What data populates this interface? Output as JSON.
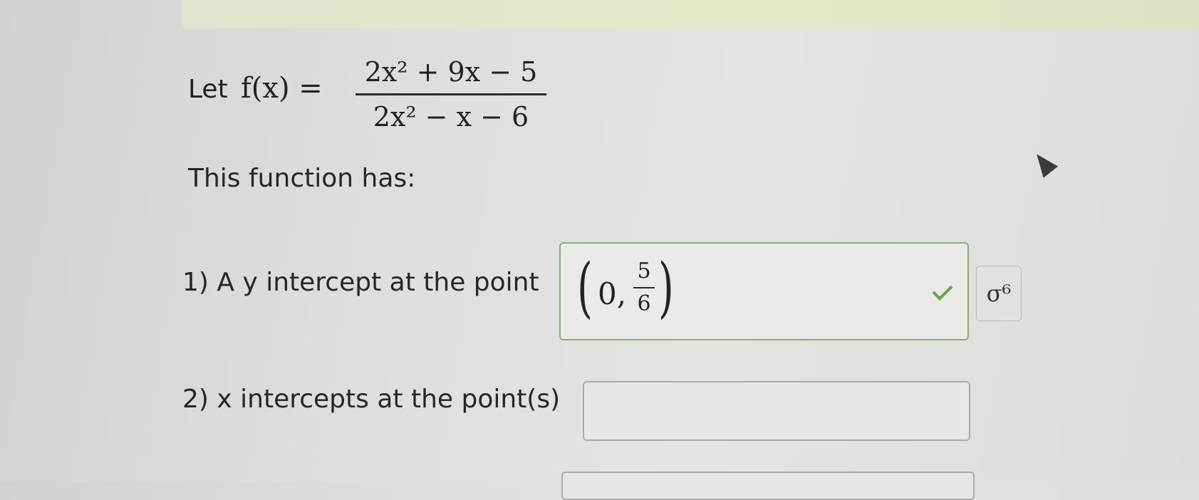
{
  "problem": {
    "let_label": "Let",
    "function_lhs": "f(x) =",
    "numerator": "2x² + 9x − 5",
    "denominator": "2x² − x − 6",
    "intro": "This function has:"
  },
  "questions": [
    {
      "label": "1) A y intercept at the point",
      "answer_open": "(",
      "answer_zero": "0,",
      "answer_num": "5",
      "answer_den": "6",
      "answer_close": ")",
      "status": "correct"
    },
    {
      "label": "2) x intercepts at the point(s)",
      "answer": ""
    }
  ],
  "tools": {
    "keypad_label": "σ⁶"
  },
  "colors": {
    "correct_border": "#7fb36b",
    "check": "#65a54b"
  }
}
